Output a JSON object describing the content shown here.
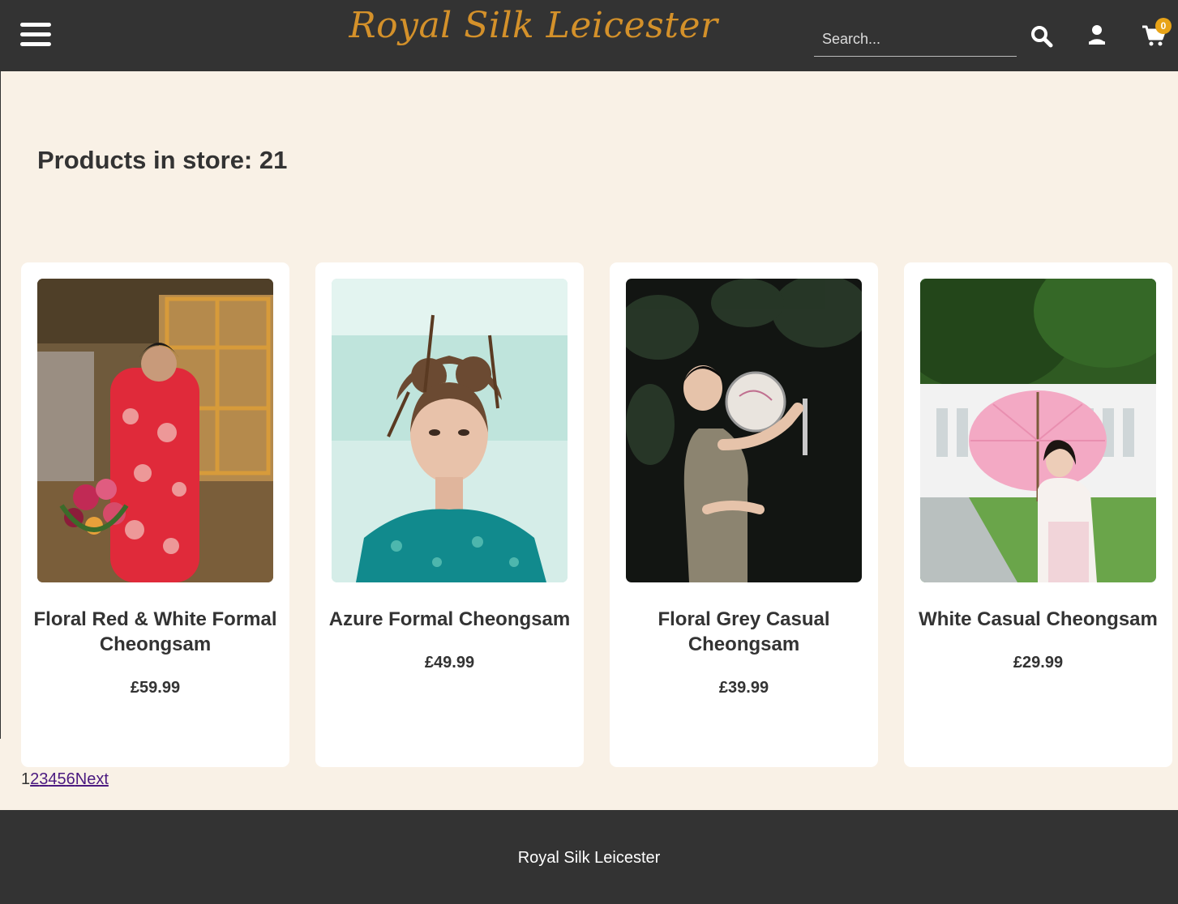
{
  "header": {
    "brand": "Royal Silk Leicester",
    "search_placeholder": "Search...",
    "cart_count": "0",
    "icons": [
      "menu-icon",
      "search-icon",
      "user-icon",
      "cart-icon"
    ]
  },
  "main": {
    "title": "Products in store: 21"
  },
  "products": [
    {
      "name": "Floral Red & White Formal Cheongsam",
      "price": "£59.99"
    },
    {
      "name": "Azure Formal Cheongsam",
      "price": "£49.99"
    },
    {
      "name": "Floral Grey Casual Cheongsam",
      "price": "£39.99"
    },
    {
      "name": "White Casual Cheongsam",
      "price": "£29.99"
    }
  ],
  "pagination": {
    "current": "1",
    "pages": [
      "2",
      "3",
      "4",
      "5",
      "6"
    ],
    "next": "Next"
  },
  "footer": {
    "text": "Royal Silk Leicester"
  },
  "colors": {
    "header_bg": "#333333",
    "brand": "#d4912a",
    "page_bg": "#f9f1e6",
    "badge": "#e8a317",
    "link": "#4b1a80"
  }
}
